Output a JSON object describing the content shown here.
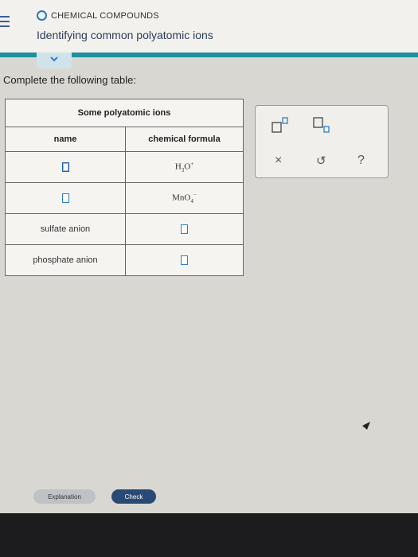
{
  "header": {
    "topic": "CHEMICAL COMPOUNDS",
    "title": "Identifying common polyatomic ions"
  },
  "prompt": "Complete the following table:",
  "table": {
    "caption": "Some polyatomic ions",
    "col_name": "name",
    "col_formula": "chemical formula",
    "rows": [
      {
        "name": "",
        "formula": {
          "base": "H",
          "sub": "3",
          "mid": "O",
          "sup": "+"
        }
      },
      {
        "name": "",
        "formula": {
          "base": "MnO",
          "sub": "4",
          "mid": "",
          "sup": "−"
        }
      },
      {
        "name": "sulfate anion",
        "formula": null
      },
      {
        "name": "phosphate anion",
        "formula": null
      }
    ]
  },
  "toolbox": {
    "icons": [
      "superscript-icon",
      "subscript-icon",
      "clear-icon",
      "undo-icon",
      "help-icon"
    ],
    "clear_glyph": "×",
    "undo_glyph": "↺",
    "help_glyph": "?"
  },
  "buttons": {
    "explanation": "Explanation",
    "check": "Check"
  },
  "colors": {
    "accent": "#1f8f9c",
    "box": "#2f7dc8",
    "check_button": "#2a4a76"
  }
}
